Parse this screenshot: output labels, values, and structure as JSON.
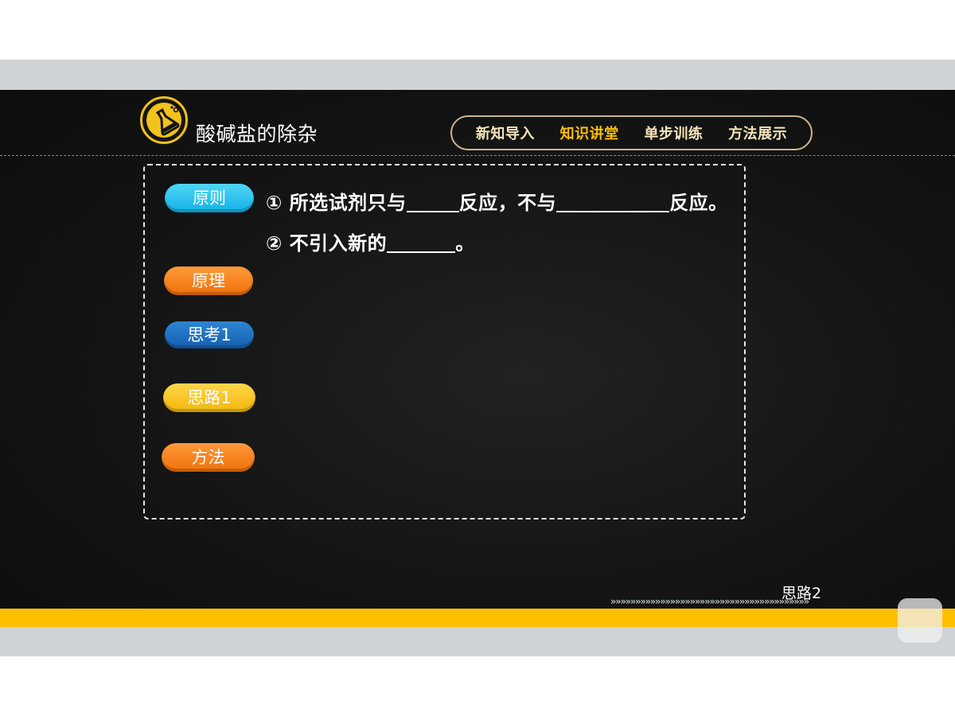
{
  "header": {
    "title": "酸碱盐的除杂",
    "logo_icon": "flask-icon",
    "nav": [
      {
        "label": "新知导入",
        "active": false
      },
      {
        "label": "知识讲堂",
        "active": true
      },
      {
        "label": "单步训练",
        "active": false
      },
      {
        "label": "方法展示",
        "active": false
      }
    ]
  },
  "sidebar": {
    "buttons": [
      {
        "label": "原则",
        "color": "#13b0e6"
      },
      {
        "label": "原理",
        "color": "#f07008"
      },
      {
        "label": "思考1",
        "color": "#155fae"
      },
      {
        "label": "思路1",
        "color": "#f2b60c"
      },
      {
        "label": "方法",
        "color": "#f07008"
      }
    ]
  },
  "content": {
    "line1": {
      "prefix": "① 所选试剂只与",
      "middle": "反应，不与",
      "suffix": "反应。"
    },
    "line2": {
      "prefix": "② 不引入新的",
      "suffix": "。"
    }
  },
  "footer": {
    "next_label": "思路2",
    "chevrons": "»»»»»»»»»»»»»»»»»»»»»»»»»»»»»»»»»»»»»»»»"
  },
  "colors": {
    "accent": "#ffc000",
    "board": "#141414",
    "frame_gray": "#d0d3d6"
  }
}
